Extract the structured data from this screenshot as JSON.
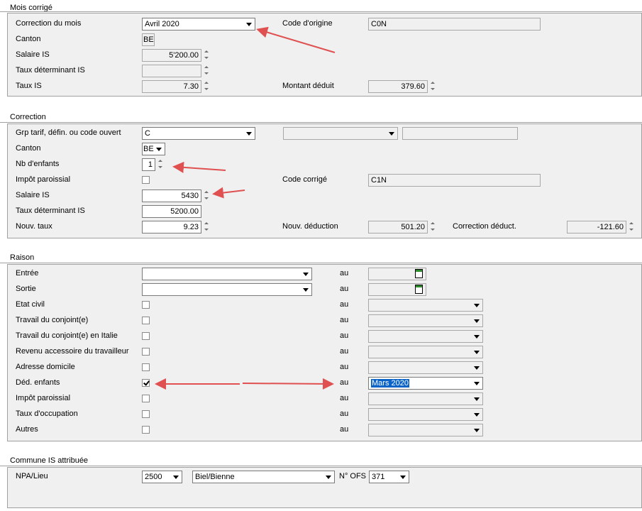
{
  "mois": {
    "title": "Mois corrigé",
    "correction_label": "Correction du mois",
    "correction_value": "Avril 2020",
    "canton_label": "Canton",
    "canton_value": "BE",
    "salaire_label": "Salaire IS",
    "salaire_value": "5'200.00",
    "taux_det_label": "Taux déterminant IS",
    "taux_det_value": "",
    "taux_label": "Taux IS",
    "taux_value": "7.30",
    "code_origine_label": "Code d'origine",
    "code_origine_value": "C0N",
    "montant_label": "Montant déduit",
    "montant_value": "379.60"
  },
  "correction": {
    "title": "Correction",
    "grp_label": "Grp tarif, défin. ou code ouvert",
    "grp_value": "C",
    "grp_extra_value": "",
    "grp_text_value": "",
    "canton_label": "Canton",
    "canton_value": "BE",
    "enfants_label": "Nb d'enfants",
    "enfants_value": "1",
    "impot_label": "Impôt paroissial",
    "code_corrige_label": "Code corrigé",
    "code_corrige_value": "C1N",
    "salaire_label": "Salaire IS",
    "salaire_value": "5430",
    "taux_det_label": "Taux déterminant IS",
    "taux_det_value": "5200.00",
    "nouv_taux_label": "Nouv. taux",
    "nouv_taux_value": "9.23",
    "nouv_deduction_label": "Nouv. déduction",
    "nouv_deduction_value": "501.20",
    "correction_deduct_label": "Correction déduct.",
    "correction_deduct_value": "-121.60"
  },
  "raison": {
    "title": "Raison",
    "au_label": "au",
    "entree_label": "Entrée",
    "sortie_label": "Sortie",
    "rows": [
      {
        "label": "Etat civil",
        "checked": false,
        "value": ""
      },
      {
        "label": "Travail du conjoint(e)",
        "checked": false,
        "value": ""
      },
      {
        "label": "Travail du conjoint(e) en Italie",
        "checked": false,
        "value": ""
      },
      {
        "label": "Revenu accessoire du travailleur",
        "checked": false,
        "value": ""
      },
      {
        "label": "Adresse domicile",
        "checked": false,
        "value": ""
      },
      {
        "label": "Déd. enfants",
        "checked": true,
        "value": "Mars 2020"
      },
      {
        "label": "Impôt paroissial",
        "checked": false,
        "value": ""
      },
      {
        "label": "Taux d'occupation",
        "checked": false,
        "value": ""
      },
      {
        "label": "Autres",
        "checked": false,
        "value": ""
      }
    ]
  },
  "commune": {
    "title": "Commune IS attribuée",
    "npa_label": "NPA/Lieu",
    "npa_value": "2500",
    "lieu_value": "Biel/Bienne",
    "ofs_label": "N° OFS",
    "ofs_value": "371"
  },
  "colors": {
    "panel": "#f0f0f0",
    "border": "#a0a0a0",
    "arrow": "#e05050",
    "selection": "#0a64c8"
  }
}
